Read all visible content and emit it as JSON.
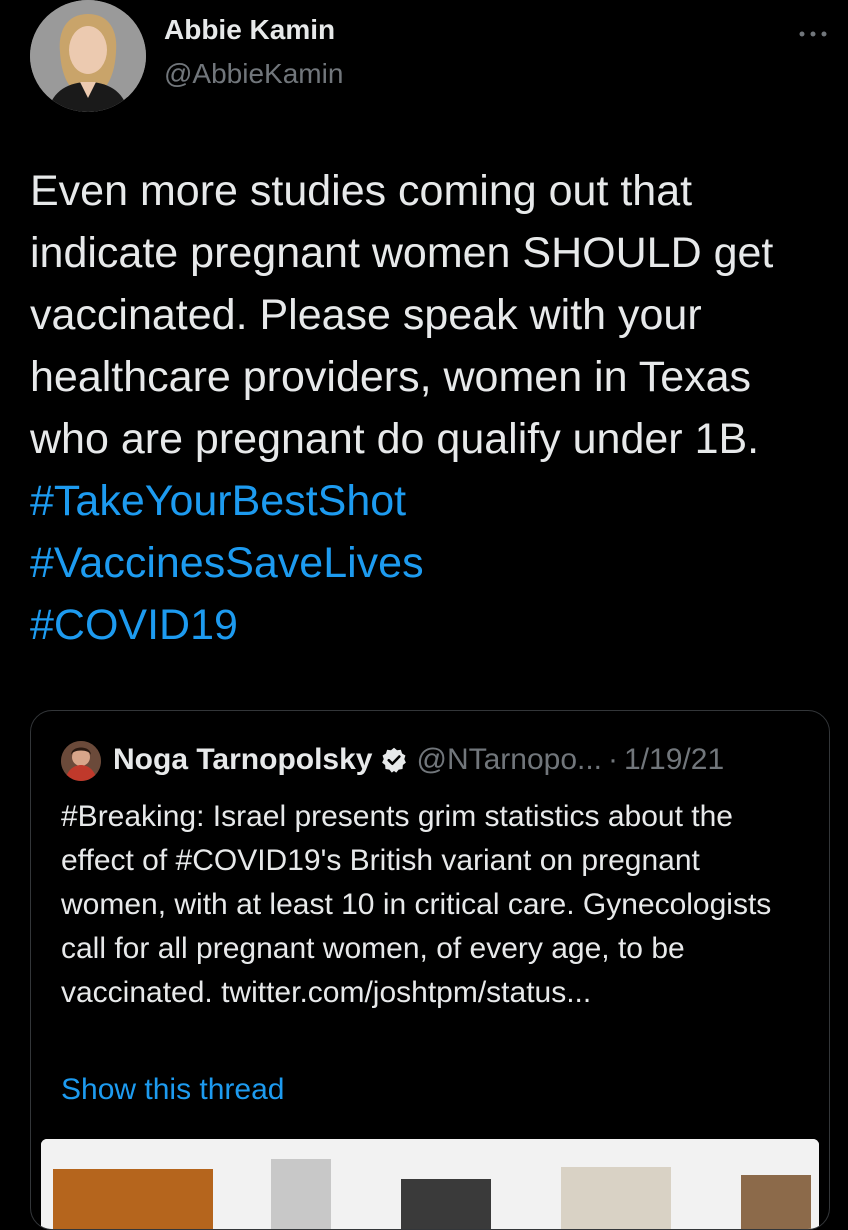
{
  "tweet": {
    "author_name": "Abbie Kamin",
    "author_handle": "@AbbieKamin",
    "more_icon": "more-dots-icon",
    "text_plain": "Even more studies coming out that indicate pregnant women SHOULD get vaccinated. Please speak with your healthcare providers, women in Texas who are pregnant do qualify under 1B.",
    "hashtags": [
      "#TakeYourBestShot",
      "#VaccinesSaveLives",
      "#COVID19"
    ]
  },
  "quote": {
    "author_name": "Noga Tarnopolsky",
    "author_handle": "@NTarnopo...",
    "separator": "·",
    "date": "1/19/21",
    "verified_icon": "verified-badge-icon",
    "text": "#Breaking: Israel presents grim statistics about the effect of #COVID19's British variant on pregnant women, with at least 10 in critical care. Gynecologists call for all pregnant women, of every age, to be vaccinated. twitter.com/joshtpm/status...",
    "show_thread": "Show this thread"
  },
  "colors": {
    "background": "#000000",
    "text": "#e7e9ea",
    "secondary": "#71767b",
    "link": "#1d9bf0",
    "border": "#333639"
  }
}
